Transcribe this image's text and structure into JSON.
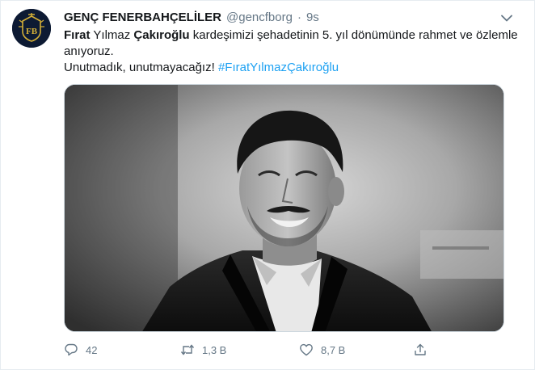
{
  "tweet": {
    "author_name": "GENÇ FENERBAHÇELİLER",
    "handle": "@gencfborg",
    "separator": "·",
    "time": "9s",
    "line1": {
      "first_name": "Fırat",
      "middle_name": " Yılmaz ",
      "last_name": "Çakıroğlu",
      "rest": " kardeşimizi şehadetinin 5. yıl dönümünde rahmet ve özlemle anıyoruz."
    },
    "line2": {
      "text": "Unutmadık, unutmayacağız! ",
      "hashtag": "#FıratYılmazÇakıroğlu"
    },
    "avatar_text": "FB"
  },
  "actions": {
    "reply_count": "42",
    "retweet_count": "1,3 B",
    "like_count": "8,7 B"
  },
  "icons": {
    "reply": "reply-icon",
    "retweet": "retweet-icon",
    "like": "like-icon",
    "share": "share-icon",
    "more": "chevron-down-icon"
  },
  "colors": {
    "text": "#14171a",
    "secondary": "#657786",
    "link": "#1da1f2",
    "avatar_bg": "#0d1a33",
    "avatar_gold": "#d4af37"
  }
}
